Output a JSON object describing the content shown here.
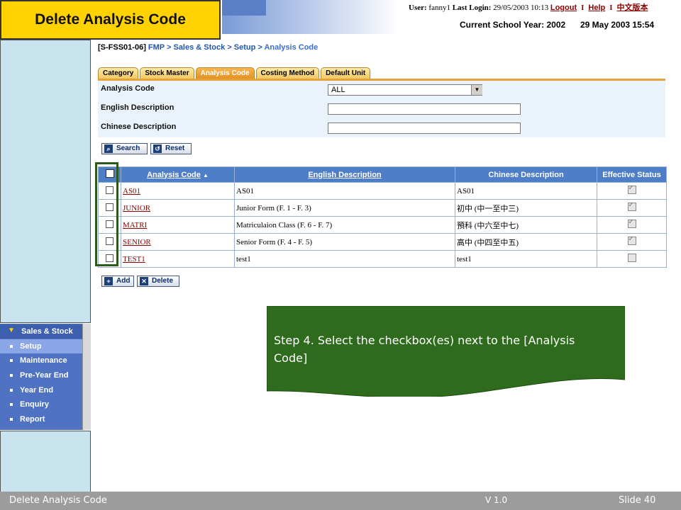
{
  "slide_title": "Delete Analysis Code",
  "header": {
    "user_label": "User:",
    "user_name": "fanny1",
    "last_login_label": "Last Login:",
    "last_login_value": "29/05/2003 10:13",
    "logout": "Logout",
    "separator": "I",
    "help": "Help",
    "chinese_version": "中文版本",
    "school_year": "Current School Year: 2002",
    "date_time": "29 May 2003 15:54"
  },
  "sidebar": {
    "menu_title": "Sales & Stock",
    "items": [
      {
        "label": "Setup"
      },
      {
        "label": "Maintenance"
      },
      {
        "label": "Pre-Year End"
      },
      {
        "label": "Year End"
      },
      {
        "label": "Enquiry"
      },
      {
        "label": "Report"
      }
    ]
  },
  "breadcrumb": {
    "code": "[S-FSS01-06]",
    "path": "FMP > Sales & Stock > Setup >",
    "current": "Analysis Code"
  },
  "tabs": [
    {
      "label": "Category"
    },
    {
      "label": "Stock Master"
    },
    {
      "label": "Analysis Code"
    },
    {
      "label": "Costing Method"
    },
    {
      "label": "Default Unit"
    }
  ],
  "form": {
    "analysis_code_label": "Analysis Code",
    "analysis_code_value": "ALL",
    "english_desc_label": "English Description",
    "english_desc_value": "",
    "chinese_desc_label": "Chinese Description",
    "chinese_desc_value": "",
    "search_button": "Search",
    "reset_button": "Reset"
  },
  "table": {
    "columns": [
      "Analysis Code",
      "English Description",
      "Chinese Description",
      "Effective Status"
    ],
    "rows": [
      {
        "code": "AS01",
        "english": "AS01",
        "chinese": "AS01",
        "effective": true
      },
      {
        "code": "JUNIOR",
        "english": "Junior Form (F. 1 - F. 3)",
        "chinese": "初中 (中一至中三)",
        "effective": true
      },
      {
        "code": "MATRI",
        "english": "Matriculaion Class (F. 6 - F. 7)",
        "chinese": "預科 (中六至中七)",
        "effective": true
      },
      {
        "code": "SENIOR",
        "english": "Senior Form (F. 4 - F. 5)",
        "chinese": "高中 (中四至中五)",
        "effective": true
      },
      {
        "code": "TEST1",
        "english": "test1",
        "chinese": "test1",
        "effective": false
      }
    ]
  },
  "actions": {
    "add_button": "Add",
    "delete_button": "Delete"
  },
  "callout": {
    "text": "Step 4. Select the checkbox(es) next to the [Analysis Code]"
  },
  "footer": {
    "left": "Delete Analysis Code",
    "version": "V 1.0",
    "slide": "Slide 40"
  },
  "colors": {
    "title_bg": "#ffd200",
    "callout_bg": "#2e6b1c",
    "header_blue": "#4f7ec8",
    "footer_bg": "#9c9c9c"
  }
}
